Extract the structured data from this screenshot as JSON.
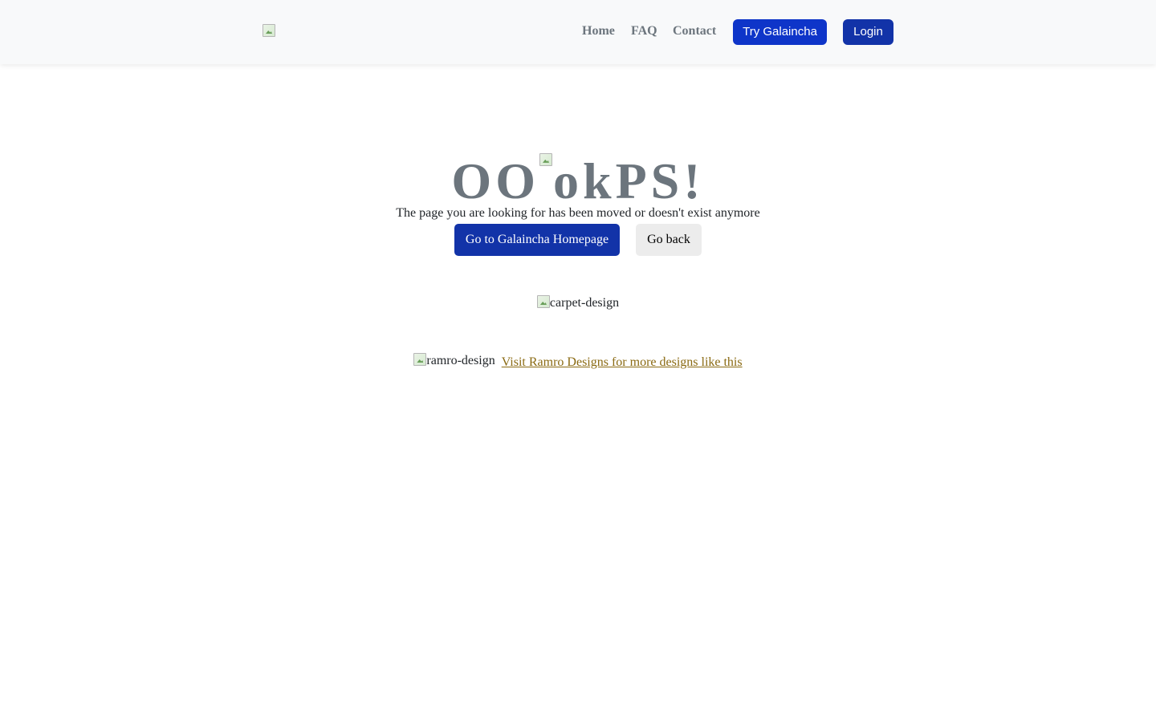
{
  "navbar": {
    "links": {
      "home": "Home",
      "faq": "FAQ",
      "contact": "Contact"
    },
    "try_button": "Try Galaincha",
    "login_button": "Login"
  },
  "hero": {
    "title_left": "OO",
    "title_right": "okPS!",
    "subtitle": "The page you are looking for has been moved or doesn't exist anymore",
    "home_button": "Go to Galaincha Homepage",
    "back_button": "Go back"
  },
  "images": {
    "carpet_alt": "carpet-design",
    "ramro_alt": "ramro-design"
  },
  "footer": {
    "link_text": "Visit Ramro Designs for more designs like this"
  },
  "colors": {
    "primary": "#1233a8",
    "try_button": "#0e35c9",
    "muted": "#6c757d",
    "link": "#8a6a12",
    "nav_bg": "#f8f9fa"
  },
  "icons": {
    "logo": "broken-image-icon",
    "title_image": "broken-image-icon"
  }
}
